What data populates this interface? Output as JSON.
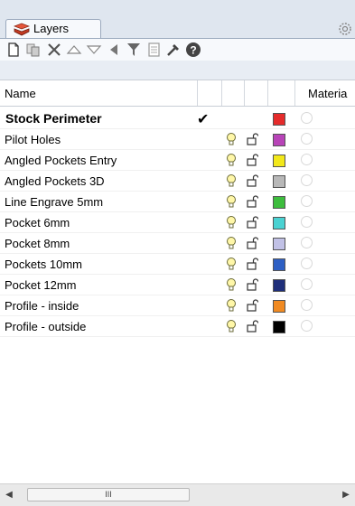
{
  "tab": {
    "label": "Layers"
  },
  "header": {
    "name": "Name",
    "material": "Materia"
  },
  "layers": [
    {
      "name": "Stock Perimeter",
      "current": true,
      "color": "#e52b2b"
    },
    {
      "name": "Pilot Holes",
      "current": false,
      "color": "#b844b8"
    },
    {
      "name": "Angled Pockets Entry",
      "current": false,
      "color": "#f2e81a"
    },
    {
      "name": "Angled Pockets 3D",
      "current": false,
      "color": "#b8b8b8"
    },
    {
      "name": "Line Engrave 5mm",
      "current": false,
      "color": "#3dbd3d"
    },
    {
      "name": "Pocket 6mm",
      "current": false,
      "color": "#4ad2d2"
    },
    {
      "name": "Pocket 8mm",
      "current": false,
      "color": "#c1c1e6"
    },
    {
      "name": "Pockets 10mm",
      "current": false,
      "color": "#2d5fc4"
    },
    {
      "name": "Pocket 12mm",
      "current": false,
      "color": "#1f2f7a"
    },
    {
      "name": "Profile - inside",
      "current": false,
      "color": "#f08a22"
    },
    {
      "name": "Profile - outside",
      "current": false,
      "color": "#000000"
    }
  ],
  "scrollbar": {
    "grip": "III"
  },
  "icons": {
    "tab": "layers-icon",
    "toolbar": [
      "new-layer-icon",
      "new-sublayer-icon",
      "delete-icon",
      "move-up-icon",
      "move-down-icon",
      "move-out-icon",
      "filter-icon",
      "properties-icon",
      "tools-icon",
      "help-icon"
    ],
    "settings": "gear-icon"
  },
  "colors": {
    "accent": "#d42c2c",
    "tab_bg": "#dfe6ef",
    "selection": "#ffffff"
  }
}
